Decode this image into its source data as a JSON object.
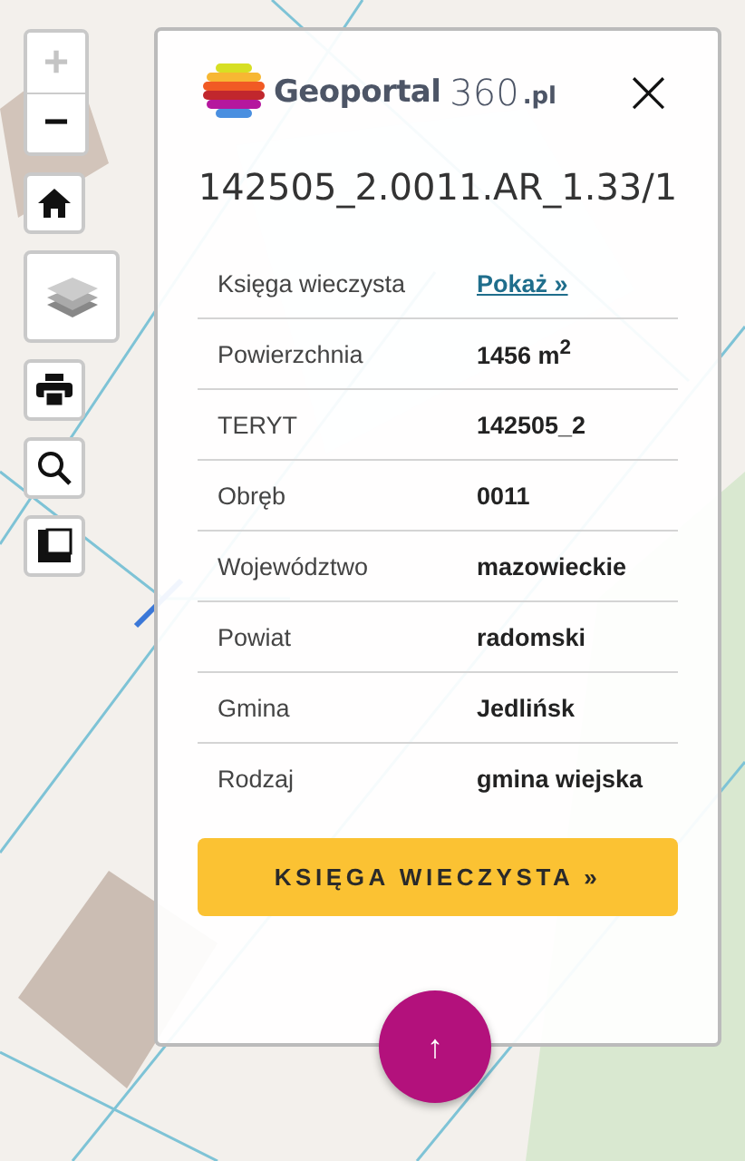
{
  "map_controls": [
    {
      "kind": "zoom",
      "items": [
        {
          "label": "+",
          "disabled": true
        },
        {
          "label": "−",
          "disabled": false
        }
      ]
    },
    {
      "kind": "home"
    },
    {
      "kind": "layers"
    },
    {
      "kind": "print"
    },
    {
      "kind": "search"
    },
    {
      "kind": "measure"
    }
  ],
  "panel": {
    "logo": {
      "name": "Geoportal",
      "number": "360",
      "suffix": ".pl"
    },
    "close": "×",
    "title": "142505_2.0011.AR_1.33/1",
    "rows": [
      {
        "label": "Księga wieczysta",
        "value": "Pokaż »",
        "kind": "link"
      },
      {
        "label": "Powierzchnia",
        "value": "1456 m$^{2}$",
        "kind": "text"
      },
      {
        "label": "TERYT",
        "value": "142505_2",
        "kind": "text"
      },
      {
        "label": "Obręb",
        "value": "0011",
        "kind": "text"
      },
      {
        "label": "Województwo",
        "value": "mazowieckie",
        "kind": "text"
      },
      {
        "label": "Powiat",
        "value": "radomski",
        "kind": "text"
      },
      {
        "label": "Gmina",
        "value": "Jedlińsk",
        "kind": "text"
      },
      {
        "label": "Rodzaj",
        "value": "gmina wiejska",
        "kind": "text"
      }
    ],
    "button": "KSIĘGA WIECZYSTA »"
  },
  "fab": "↑"
}
